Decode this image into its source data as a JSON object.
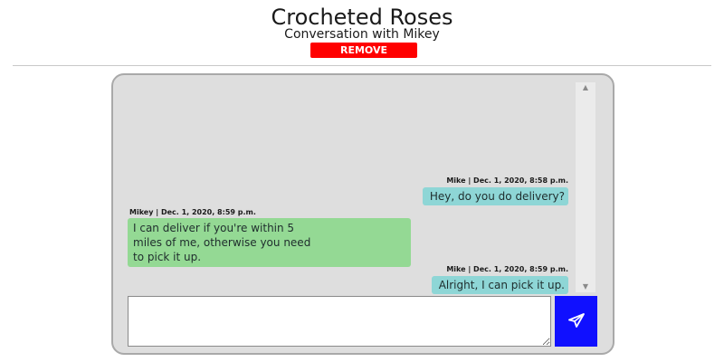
{
  "header": {
    "title": "Crocheted Roses",
    "subtitle": "Conversation with Mikey",
    "remove_label": "REMOVE"
  },
  "messages": [
    {
      "direction": "sent",
      "meta": "Mike | Dec. 1, 2020, 8:58 p.m.",
      "text": "Hey, do you do delivery?"
    },
    {
      "direction": "received",
      "meta": "Mikey | Dec. 1, 2020, 8:59 p.m.",
      "text": "I can deliver if you're within 5\nmiles of me, otherwise you need\nto pick it up."
    },
    {
      "direction": "sent",
      "meta": "Mike | Dec. 1, 2020, 8:59 p.m.",
      "text": "Alright, I can pick it up."
    }
  ],
  "composer": {
    "value": "",
    "send_icon": "paper-plane-icon"
  },
  "colors": {
    "accent": "#1010ff",
    "remove": "#ff0000",
    "sent_bubble": "#8ed6d6",
    "received_bubble": "#94d994",
    "panel": "#dedede"
  }
}
